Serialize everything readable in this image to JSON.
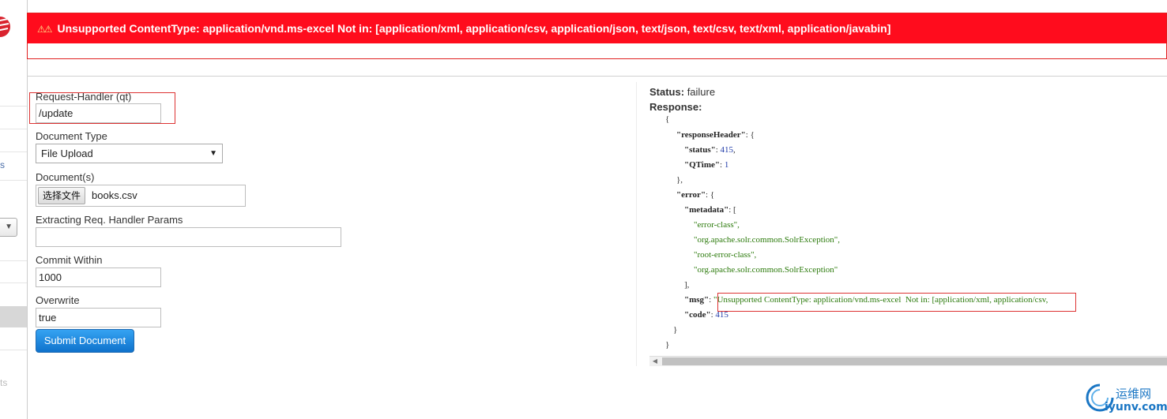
{
  "error": {
    "icon": "warning-icon",
    "message": "Unsupported ContentType: application/vnd.ms-excel Not in: [application/xml, application/csv, application/json, text/json, text/csv, text/xml, application/javabin]"
  },
  "sidebar": {
    "fragment_1": "s",
    "fragment_2": "ts"
  },
  "form": {
    "request_handler_label": "Request-Handler (qt)",
    "request_handler_value": "/update",
    "document_type_label": "Document Type",
    "document_type_value": "File Upload",
    "documents_label": "Document(s)",
    "choose_file_label": "选择文件",
    "file_name": "books.csv",
    "extracting_params_label": "Extracting Req. Handler Params",
    "extracting_params_value": "",
    "commit_within_label": "Commit Within",
    "commit_within_value": "1000",
    "overwrite_label": "Overwrite",
    "overwrite_value": "true",
    "submit_label": "Submit Document"
  },
  "response": {
    "status_label": "Status:",
    "status_value": "failure",
    "response_label": "Response:",
    "json": {
      "open_brace": "{",
      "responseHeader_key": "\"responseHeader\"",
      "status_key": "\"status\"",
      "status_value": "415",
      "qtime_key": "\"QTime\"",
      "qtime_value": "1",
      "close_obj": "},",
      "error_key": "\"error\"",
      "metadata_key": "\"metadata\"",
      "meta_1": "\"error-class\",",
      "meta_2": "\"org.apache.solr.common.SolrException\",",
      "meta_3": "\"root-error-class\",",
      "meta_4": "\"org.apache.solr.common.SolrException\"",
      "close_arr": "],",
      "msg_key": "\"msg\"",
      "msg_value": "\"Unsupported ContentType: application/vnd.ms-excel  Not in: [application/xml, application/csv,",
      "code_key": "\"code\"",
      "code_value": "415",
      "close_inner": "}",
      "close_outer": "}"
    }
  },
  "watermark": {
    "cn": "运维网",
    "en": "iyunv.com"
  },
  "colors": {
    "error_red": "#ff0c1d",
    "button_blue": "#1a84dc",
    "string_green": "#2b7a0b",
    "number_blue": "#1f3aa8"
  }
}
